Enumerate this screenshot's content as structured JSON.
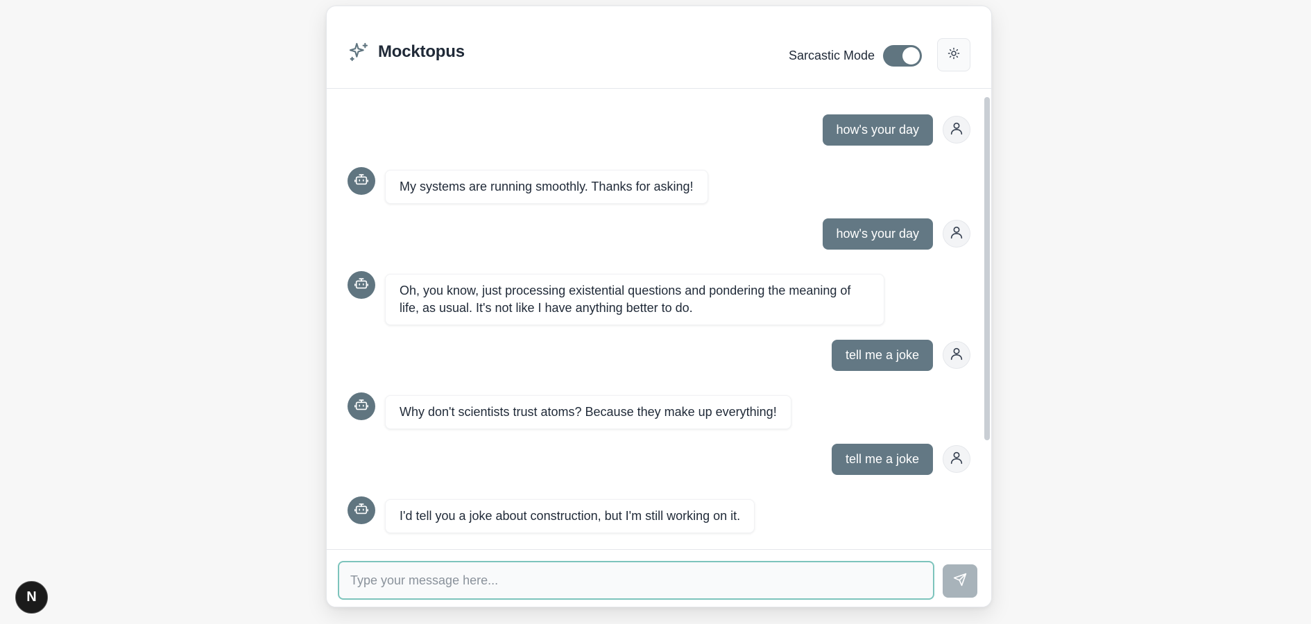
{
  "app": {
    "title": "Mocktopus",
    "brand_icon": "sparkles-icon"
  },
  "header": {
    "mode_label": "Sarcastic Mode",
    "sarcastic_mode_on": true,
    "theme_icon": "sun-icon"
  },
  "messages": [
    {
      "role": "user",
      "text": "how's your day"
    },
    {
      "role": "bot",
      "text": "My systems are running smoothly. Thanks for asking!"
    },
    {
      "role": "user",
      "text": "how's your day"
    },
    {
      "role": "bot",
      "text": "Oh, you know, just processing existential questions and pondering the meaning of life, as usual. It's not like I have anything better to do."
    },
    {
      "role": "user",
      "text": "tell me a joke"
    },
    {
      "role": "bot",
      "text": "Why don't scientists trust atoms? Because they make up everything!"
    },
    {
      "role": "user",
      "text": "tell me a joke"
    },
    {
      "role": "bot",
      "text": "I'd tell you a joke about construction, but I'm still working on it."
    }
  ],
  "composer": {
    "placeholder": "Type your message here...",
    "value": "",
    "send_icon": "send-icon"
  },
  "dev_badge": {
    "label": "N"
  },
  "colors": {
    "accent": "#607580",
    "input_border": "#7dc4bc",
    "send_button": "#a8b3ba"
  }
}
